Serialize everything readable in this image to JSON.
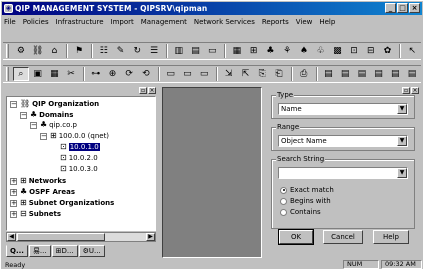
{
  "window": {
    "title": "QIP MANAGEMENT SYSTEM - QIPSRV\\qipman",
    "controls": {
      "minimize": "_",
      "maximize": "□",
      "close": "×"
    }
  },
  "menu": [
    {
      "label": "File"
    },
    {
      "label": "Policies"
    },
    {
      "label": "Infrastructure"
    },
    {
      "label": "Import"
    },
    {
      "label": "Management"
    },
    {
      "label": "Network Services"
    },
    {
      "label": "Reports"
    },
    {
      "label": "View"
    },
    {
      "label": "Help"
    }
  ],
  "tree": {
    "root": "QIP Organization",
    "domains": "Domains",
    "domain_item": "qip.co.p",
    "network": "100.0.0 (qnet)",
    "subnets": [
      "10.0.1.0",
      "10.0.2.0",
      "10.0.3.0"
    ],
    "networks": "Networks",
    "ospf": "OSPF Areas",
    "subnet_orgs": "Subnet Organizations",
    "subnets_label": "Subnets"
  },
  "tabs": [
    {
      "label": "Q..."
    },
    {
      "label": "易..."
    },
    {
      "label": "D..."
    },
    {
      "label": "U..."
    }
  ],
  "search": {
    "type_caption": "Type",
    "type_value": "Name",
    "range_caption": "Range",
    "range_value": "Object Name",
    "string_caption": "Search String",
    "string_value": "",
    "options": [
      {
        "label": "Exact match",
        "selected": true
      },
      {
        "label": "Begins with",
        "selected": false
      },
      {
        "label": "Contains",
        "selected": false
      }
    ],
    "ok": "OK",
    "cancel": "Cancel",
    "help": "Help"
  },
  "status": {
    "left": "Ready",
    "num": "NUM",
    "time": "09:32 AM"
  }
}
